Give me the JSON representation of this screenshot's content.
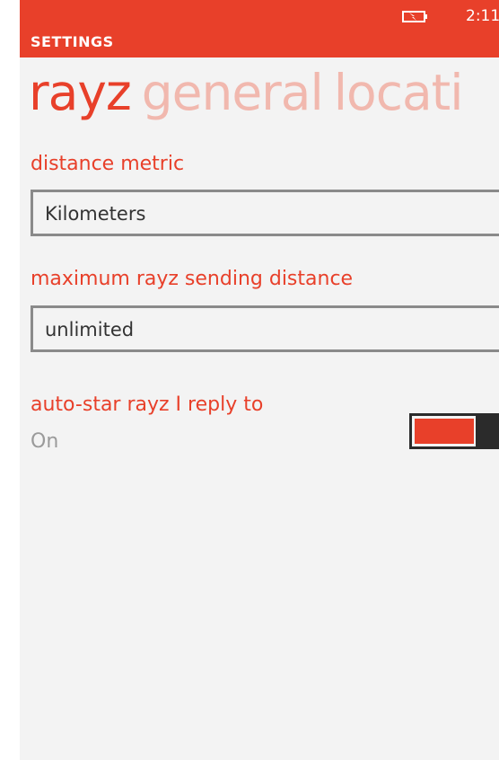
{
  "status_bar": {
    "time": "2:11",
    "battery_icon": "battery-charging-icon",
    "background_color": "#e8402a"
  },
  "header": {
    "app_title": "SETTINGS"
  },
  "pivot": {
    "items": [
      {
        "label": "rayz",
        "active": true
      },
      {
        "label": "general",
        "active": false
      },
      {
        "label": "locati",
        "active": false
      }
    ]
  },
  "settings": {
    "distance_metric": {
      "label": "distance metric",
      "value": "Kilometers"
    },
    "max_distance": {
      "label": "maximum rayz sending distance",
      "value": "unlimited"
    },
    "auto_star": {
      "label": "auto-star rayz I reply to",
      "state_text": "On",
      "on": true
    }
  },
  "colors": {
    "accent": "#e8402a",
    "accent_light": "#f1b8ae",
    "background": "#f3f3f3"
  }
}
